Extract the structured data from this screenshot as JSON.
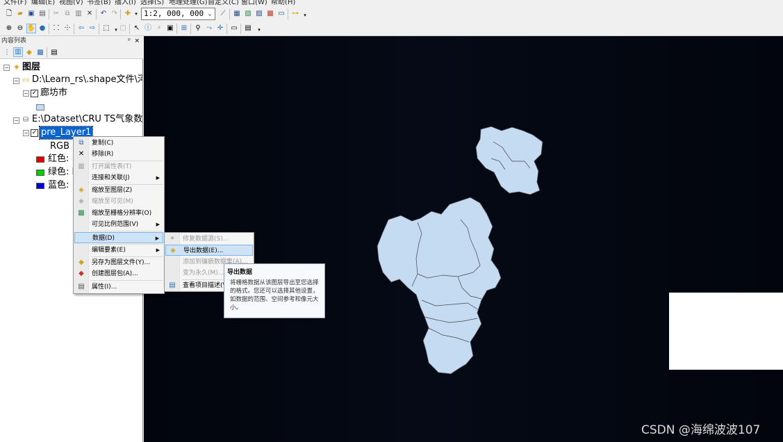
{
  "menubar": {
    "items": [
      "文件(F)",
      "编辑(E)",
      "视图(V)",
      "书签(B)",
      "插入(I)",
      "选择(S)",
      "地理处理(G)",
      "自定义(C)",
      "窗口(W)",
      "帮助(H)"
    ]
  },
  "toolbar": {
    "scale_value": "1:2, 000, 000"
  },
  "toc": {
    "title": "内容列表",
    "pin_label": "ᵖ",
    "close_label": "×",
    "root_label": "图层",
    "group1": {
      "label": "D:\\Learn_rs\\.shape文件\\河北",
      "layer_label": "廊坊市"
    },
    "group2": {
      "label": "E:\\Dataset\\CRU TS气象数据",
      "layer_label": "pre_Layer1",
      "rgb_label": "RGB",
      "bands": [
        "红色: ",
        "绿色: B",
        "蓝色: "
      ]
    }
  },
  "context_menu": {
    "items": [
      {
        "label": "复制(C)",
        "icon": "copy-icon"
      },
      {
        "label": "移除(R)",
        "icon": "remove-icon"
      },
      {
        "label": "打开属性表(T)",
        "icon": "table-icon",
        "disabled": true
      },
      {
        "label": "连接和关联(J)",
        "submenu": true
      },
      {
        "label": "缩放至图层(Z)",
        "icon": "zoom-layer-icon"
      },
      {
        "label": "缩放至可见(M)",
        "icon": "zoom-visible-icon",
        "disabled": true
      },
      {
        "label": "缩放至栅格分辨率(O)",
        "icon": "zoom-raster-icon"
      },
      {
        "label": "可见比例范围(V)",
        "submenu": true
      },
      {
        "label": "数据(D)",
        "submenu": true,
        "highlighted": true
      },
      {
        "label": "编辑要素(E)",
        "submenu": true
      },
      {
        "label": "另存为图层文件(Y)...",
        "icon": "save-layer-icon"
      },
      {
        "label": "创建图层包(A)...",
        "icon": "layer-package-icon"
      },
      {
        "label": "属性(I)...",
        "icon": "properties-icon"
      }
    ]
  },
  "submenu": {
    "items": [
      {
        "label": "修复数据源(S)...",
        "disabled": true
      },
      {
        "label": "导出数据(E)...",
        "highlighted": true
      },
      {
        "label": "添加到镶嵌数据集(A)...",
        "disabled": true
      },
      {
        "label": "变为永久(M)...",
        "disabled": true
      },
      {
        "label": "查看项目描述(V)..."
      }
    ]
  },
  "tooltip": {
    "title": "导出数据",
    "text": "将栅格数据从该图层导出至您选择的格式。您还可以选择其他设置，如数据的范围、空间参考和像元大小。"
  },
  "watermark": "CSDN @海绵波波107",
  "colors": {
    "map_background": "#02050c",
    "polygon_fill": "#c5dbf2",
    "polygon_stroke": "#4a4a4a",
    "highlight": "#cfe3f7"
  }
}
